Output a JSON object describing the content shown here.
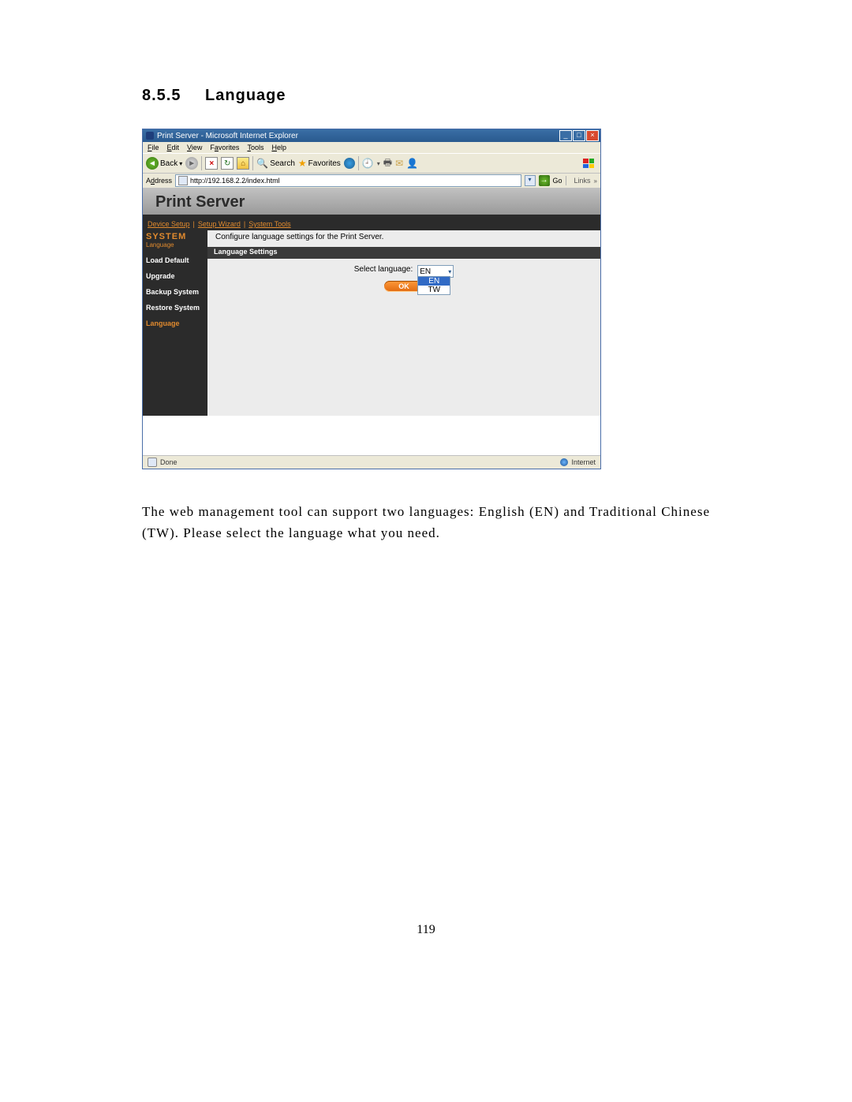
{
  "doc": {
    "section_number": "8.5.5",
    "section_title": "Language",
    "paragraph": "The web management tool can support two languages: English (EN) and Traditional Chinese (TW). Please select the language what you need.",
    "page_number": "119"
  },
  "ie": {
    "window_title": "Print Server - Microsoft Internet Explorer",
    "menu": {
      "file": "File",
      "edit": "Edit",
      "view": "View",
      "favorites": "Favorites",
      "tools": "Tools",
      "help": "Help"
    },
    "toolbar": {
      "back": "Back",
      "search": "Search",
      "favorites": "Favorites"
    },
    "address": {
      "label": "Address",
      "url": "http://192.168.2.2/index.html",
      "go": "Go",
      "links": "Links"
    },
    "status": {
      "done": "Done",
      "zone": "Internet"
    }
  },
  "app": {
    "banner_title": "Print Server",
    "topnav": {
      "device_setup": "Device Setup",
      "setup_wizard": "Setup Wizard",
      "system_tools": "System Tools"
    },
    "sidebar": {
      "heading": "SYSTEM",
      "subheading": "Language",
      "items": [
        {
          "label": "Load Default",
          "active": false
        },
        {
          "label": "Upgrade",
          "active": false
        },
        {
          "label": "Backup System",
          "active": false
        },
        {
          "label": "Restore System",
          "active": false
        },
        {
          "label": "Language",
          "active": true
        }
      ]
    },
    "main": {
      "description": "Configure language settings for the Print Server.",
      "panel_title": "Language Settings",
      "select_label": "Select language:",
      "select_value": "EN",
      "options": [
        "EN",
        "TW"
      ],
      "ok_label": "OK"
    }
  }
}
